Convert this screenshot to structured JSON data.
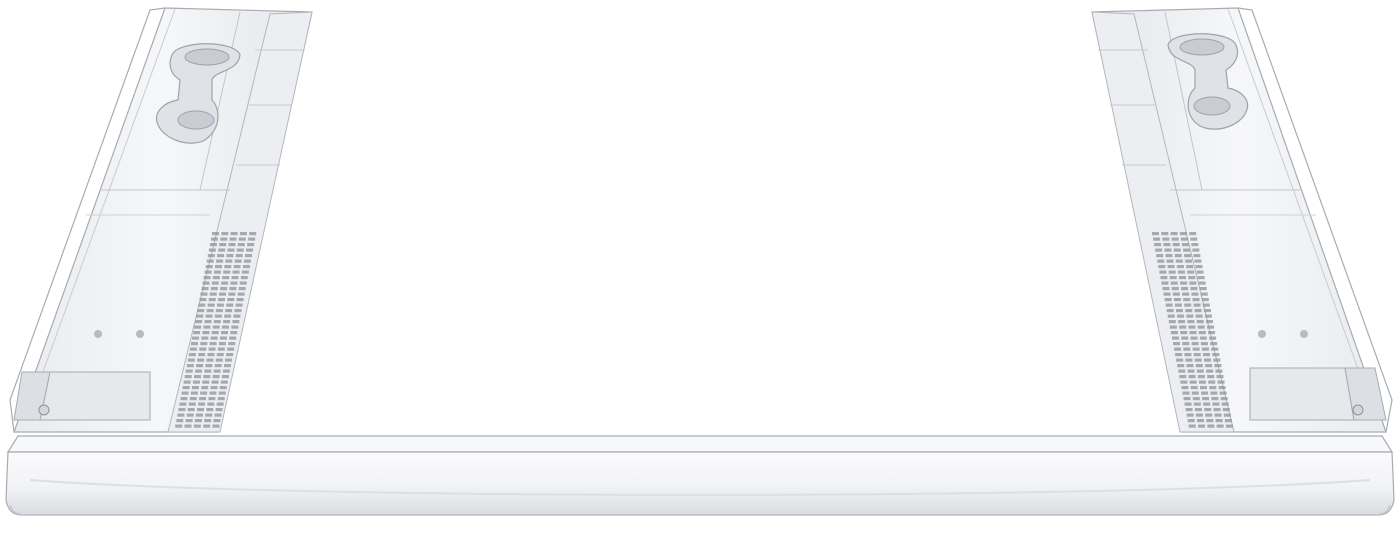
{
  "image": {
    "subject": "washer-dryer-stacking-frame",
    "colors": {
      "background": "#ffffff",
      "plastic": "#f3f4f6",
      "plastic_shade": "#e2e4e8",
      "edge": "#a7abb2",
      "deep": "#c9ccd2",
      "vent": "#8f939a"
    }
  }
}
